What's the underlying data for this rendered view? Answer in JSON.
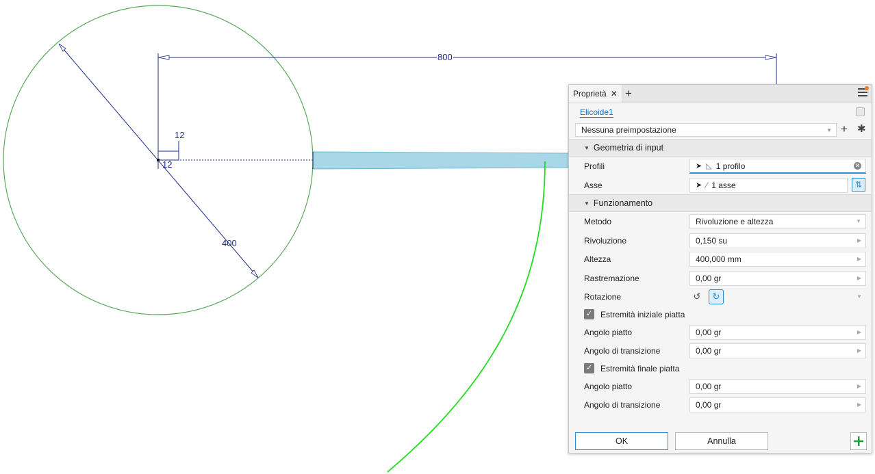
{
  "drawing": {
    "dimension_horizontal": "800",
    "dimension_diameter": "400",
    "dimension_small_a": "12",
    "dimension_small_b": "12",
    "colors": {
      "circle": "#5aa85a",
      "dimension": "#1e2a8c",
      "helix": "#22dd22",
      "profile_fill": "#a8d8e8"
    }
  },
  "panel": {
    "tab_title": "Proprietà",
    "feature_name": "Elicoide1",
    "preset": "Nessuna preimpostazione",
    "sections": {
      "input": "Geometria di input",
      "behavior": "Funzionamento"
    },
    "profili": {
      "label": "Profili",
      "value": "1 profilo"
    },
    "asse": {
      "label": "Asse",
      "value": "1 asse"
    },
    "metodo": {
      "label": "Metodo",
      "value": "Rivoluzione e altezza"
    },
    "rivoluzione": {
      "label": "Rivoluzione",
      "value": "0,150 su"
    },
    "altezza": {
      "label": "Altezza",
      "value": "400,000 mm"
    },
    "rastremazione": {
      "label": "Rastremazione",
      "value": "0,00 gr"
    },
    "rotazione": {
      "label": "Rotazione"
    },
    "start_flat": {
      "label": "Estremità iniziale piatta",
      "checked": true,
      "angolo_piatto": {
        "label": "Angolo piatto",
        "value": "0,00 gr"
      },
      "angolo_transizione": {
        "label": "Angolo di transizione",
        "value": "0,00 gr"
      }
    },
    "end_flat": {
      "label": "Estremità finale piatta",
      "checked": true,
      "angolo_piatto": {
        "label": "Angolo piatto",
        "value": "0,00 gr"
      },
      "angolo_transizione": {
        "label": "Angolo di transizione",
        "value": "0,00 gr"
      }
    },
    "buttons": {
      "ok": "OK",
      "cancel": "Annulla"
    },
    "accent": "#2a8ad4"
  }
}
